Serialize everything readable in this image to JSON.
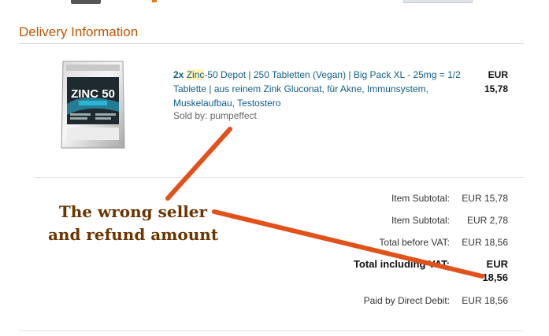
{
  "section": {
    "title": "Delivery Information"
  },
  "product": {
    "quantity": "2x",
    "name_highlight": "Zinc",
    "name_rest": "-50 Depot | 250 Tabletten (Vegan) | Big Pack XL - 25mg = 1/2 Tablette | aus reinem Zink Gluconat, für Akne, Immunsystem, Muskelaufbau, Testostero",
    "sold_by": "Sold by: pumpeffect",
    "currency": "EUR",
    "price": "15,78",
    "image_label": "ZINC 50"
  },
  "summary": {
    "rows": [
      {
        "label": "Item Subtotal:",
        "value": "EUR 15,78"
      },
      {
        "label": "Item Subtotal:",
        "value": "EUR 2,78"
      },
      {
        "label": "Total before VAT:",
        "value": "EUR 18,56"
      }
    ],
    "total": {
      "label": "Total including VAT:",
      "currency": "EUR",
      "value": "18,56"
    },
    "paid": {
      "label": "Paid by Direct Debit:",
      "value": "EUR 18,56"
    }
  },
  "annotation": {
    "line1": "The wrong seller",
    "line2": "and refund amount",
    "color": "#e0521a"
  }
}
